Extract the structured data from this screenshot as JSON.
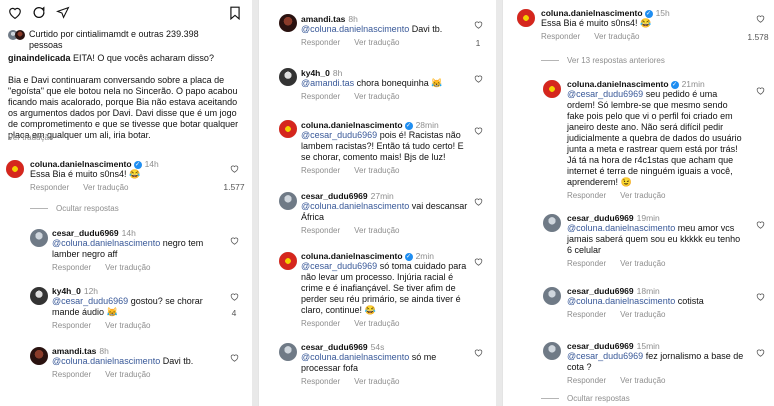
{
  "p1": {
    "liked_by": "Curtido por cintialimamdt e outras 239.398 pessoas",
    "caption_user": "ginaindelicada",
    "caption_first": "EITA! O que vocês acharam disso?",
    "caption_body": "Bia e Davi continuaram conversando sobre a placa de \"egoísta\" que ele botou nela no Sincerão. O papo acabou ficando mais acalorado, porque Bia não estava aceitando os argumentos dados por Davi. Davi disse que é um jogo de comprometimento e que se tivesse que botar qualquer placa em qualquer um ali, iria botar.",
    "see_translation": "Ver tradução",
    "main_comment": {
      "user": "coluna.danielnascimento",
      "time": "14h",
      "text": "Essa Bia é muito s0ns4! 😂",
      "reply": "Responder",
      "translate": "Ver tradução",
      "likes": "1.577"
    },
    "hide_replies": "Ocultar respostas",
    "replies": [
      {
        "user": "cesar_dudu6969",
        "time": "14h",
        "mention": "@coluna.danielnascimento",
        "text": " negro tem lamber negro aff",
        "reply": "Responder",
        "translate": "Ver tradução",
        "likes": ""
      },
      {
        "user": "ky4h_0",
        "time": "12h",
        "mention": "@cesar_dudu6969",
        "text": " gostou? se chorar mande áudio 😹",
        "reply": "Responder",
        "translate": "Ver tradução",
        "likes": "4"
      },
      {
        "user": "amandi.tas",
        "time": "8h",
        "mention": "@coluna.danielnascimento",
        "text": " Davi tb.",
        "reply": "Responder",
        "translate": "Ver tradução",
        "likes": ""
      }
    ]
  },
  "p2": {
    "comments": [
      {
        "user": "amandi.tas",
        "time": "8h",
        "mention": "@coluna.danielnascimento",
        "text": " Davi tb.",
        "reply": "Responder",
        "translate": "Ver tradução",
        "likes": "1"
      },
      {
        "user": "ky4h_0",
        "time": "8h",
        "mention": "@amandi.tas",
        "text": " chora bonequinha 😹",
        "reply": "Responder",
        "translate": "Ver tradução",
        "likes": ""
      },
      {
        "user": "coluna.danielnascimento",
        "time": "28min",
        "mention": "@cesar_dudu6969",
        "text": " pois é! Racistas não lambem racistas?! Então tá tudo certo! E se chorar, comento mais! Bjs de luz!",
        "reply": "Responder",
        "translate": "Ver tradução",
        "likes": ""
      },
      {
        "user": "cesar_dudu6969",
        "time": "27min",
        "mention": "@coluna.danielnascimento",
        "text": " vai descansar África",
        "reply": "Responder",
        "translate": "Ver tradução",
        "likes": ""
      },
      {
        "user": "coluna.danielnascimento",
        "time": "2min",
        "mention": "@cesar_dudu6969",
        "text": " só toma cuidado para não levar um processo. Injúria racial é crime e é inafiançável. Se tiver afim de perder seu réu primário, se ainda tiver é claro, continue! 😂",
        "reply": "Responder",
        "translate": "Ver tradução",
        "likes": ""
      },
      {
        "user": "cesar_dudu6969",
        "time": "54s",
        "mention": "@coluna.danielnascimento",
        "text": " só me processar fofa",
        "reply": "Responder",
        "translate": "Ver tradução",
        "likes": ""
      }
    ]
  },
  "p3": {
    "main_comment": {
      "user": "coluna.danielnascimento",
      "time": "15h",
      "text": "Essa Bia é muito s0ns4! 😂",
      "reply": "Responder",
      "translate": "Ver tradução",
      "likes": "1.578"
    },
    "more_replies": "Ver 13 respostas anteriores",
    "replies": [
      {
        "user": "coluna.danielnascimento",
        "time": "21min",
        "mention": "@cesar_dudu6969",
        "text": " seu pedido é uma ordem! Só lembre-se que mesmo sendo fake pois pelo que vi o perfil foi criado em janeiro deste ano. Não será difícil pedir judicialmente a quebra de dados do usuário junta a meta e rastrear quem está por trás! Já tá na hora de r4c1stas que acham que internet é terra de ninguém iguais a você, aprenderem! 😉",
        "reply": "Responder",
        "translate": "Ver tradução"
      },
      {
        "user": "cesar_dudu6969",
        "time": "19min",
        "mention": "@coluna.danielnascimento",
        "text": " meu amor vcs jamais saberá quem sou eu kkkkk eu tenho 6 celular",
        "reply": "Responder",
        "translate": "Ver tradução"
      },
      {
        "user": "cesar_dudu6969",
        "time": "18min",
        "mention": "@coluna.danielnascimento",
        "text": " cotista",
        "reply": "Responder",
        "translate": "Ver tradução"
      },
      {
        "user": "cesar_dudu6969",
        "time": "15min",
        "mention": "@cesar_dudu6969",
        "text": " fez jornalismo a base de cota ?",
        "reply": "Responder",
        "translate": "Ver tradução"
      }
    ],
    "hide_replies": "Ocultar respostas"
  }
}
